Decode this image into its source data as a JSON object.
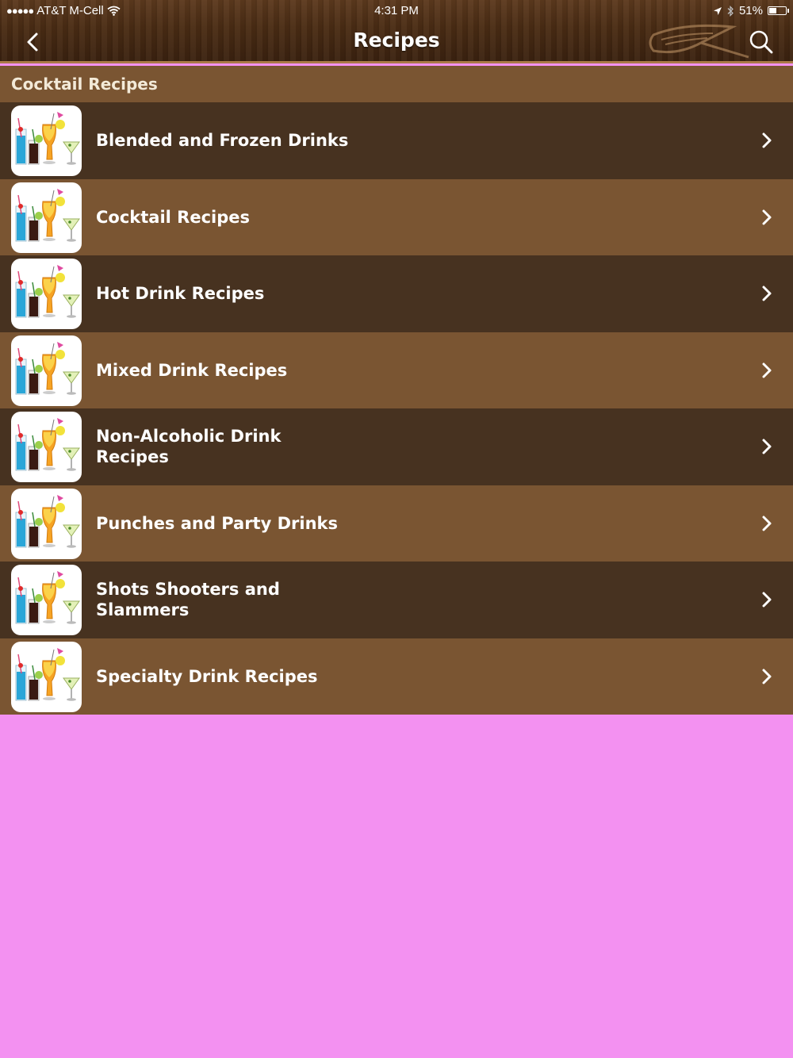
{
  "status_bar": {
    "signal": "●●●●●",
    "carrier": "AT&T M-Cell",
    "time": "4:31 PM",
    "battery_text": "51%",
    "battery_level": 0.51
  },
  "nav": {
    "title": "Recipes"
  },
  "section": {
    "header": "Cocktail Recipes"
  },
  "items": [
    {
      "label": "Blended and Frozen Drinks"
    },
    {
      "label": "Cocktail Recipes"
    },
    {
      "label": "Hot Drink Recipes"
    },
    {
      "label": "Mixed Drink Recipes"
    },
    {
      "label": "Non-Alcoholic Drink Recipes"
    },
    {
      "label": "Punches and Party Drinks"
    },
    {
      "label": "Shots Shooters and Slammers"
    },
    {
      "label": "Specialty Drink Recipes"
    }
  ],
  "colors": {
    "row_dark": "#473220",
    "row_light": "#7a5532",
    "background": "#f391f1"
  },
  "icons": {
    "back": "chevron-left-icon",
    "search": "magnifier-icon",
    "row_thumb": "cocktail-glasses-icon",
    "row_arrow": "chevron-right-icon"
  }
}
